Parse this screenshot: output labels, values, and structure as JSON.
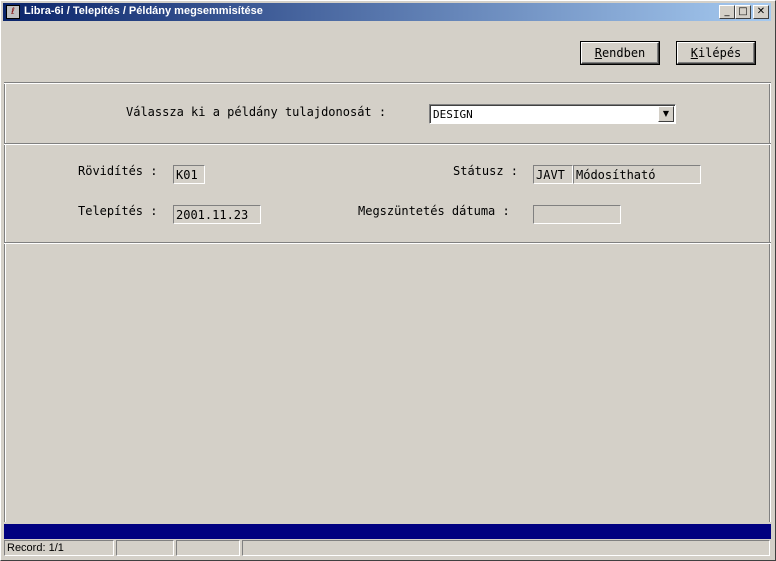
{
  "window": {
    "title": "Libra-6i / Telepítés / Példány megsemmisítése",
    "app_icon": "libra-app-icon",
    "controls": {
      "minimize": "_",
      "maximize": "□",
      "close": "✕"
    }
  },
  "toolbar": {
    "ok_first": "R",
    "ok_rest": "endben",
    "exit_first": "K",
    "exit_rest": "ilépés"
  },
  "owner": {
    "label": "Válassza ki a példány tulajdonosát :",
    "value": "DESIGN",
    "dropdown_icon": "▼"
  },
  "form": {
    "abbrev_label": "Rövidítés :",
    "abbrev_value": "K01",
    "install_label": "Telepítés :",
    "install_value": "2001.11.23",
    "status_label": "Státusz :",
    "status_code": "JAVT",
    "status_text": "Módosítható",
    "end_date_label": "Megszüntetés dátuma :",
    "end_date_value": ""
  },
  "statusbar": {
    "record": "Record: 1/1",
    "cell2": "",
    "cell3": "",
    "cell4": ""
  },
  "colors": {
    "title_start": "#0a246a",
    "title_end": "#a6caf0",
    "progress_bar": "#000080",
    "face": "#d4d0c8"
  }
}
